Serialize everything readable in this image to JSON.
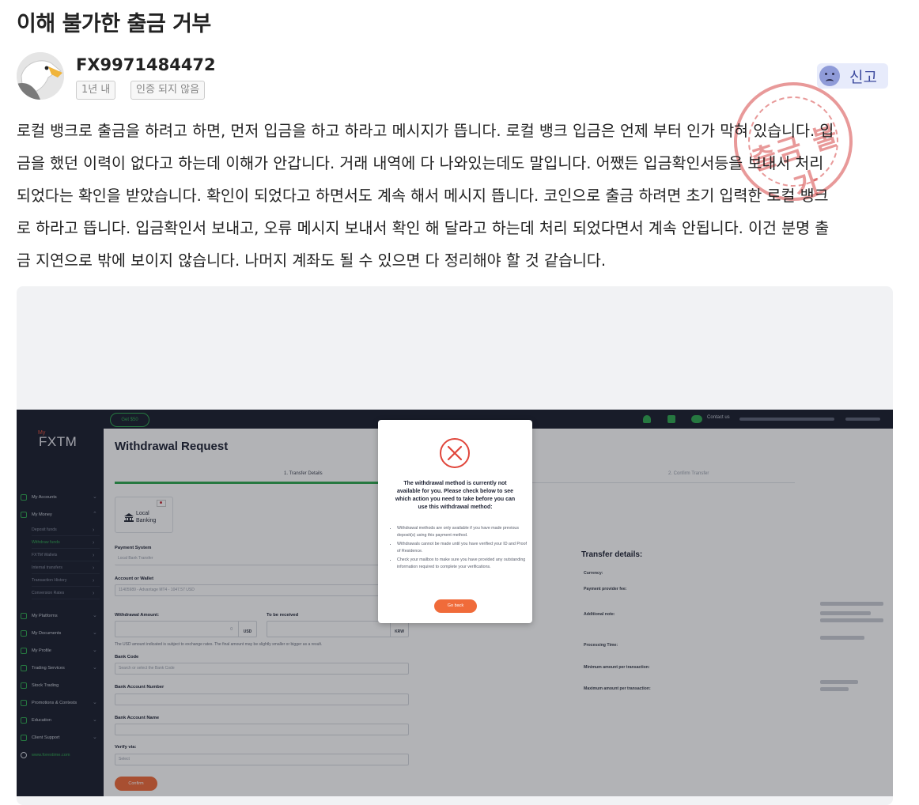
{
  "post": {
    "title": "이해 불가한 출금 거부",
    "author": "FX9971484472",
    "time_badge": "1년 내",
    "verify_badge": "인증 되지 않음",
    "report_label": "신고",
    "stamp_text": "출금 불가",
    "body_lines": [
      "로컬 뱅크로 출금을 하려고 하면, 먼저 입금을 하고 하라고 메시지가 뜹니다. 로컬 뱅크 입금은 언제 부터 인가 막혀 있습니다. 입",
      "금을 했던 이력이 없다고 하는데 이해가 안갑니다. 거래 내역에 다 나와있는데도 말입니다. 어쨌든 입금확인서등을 보내서 처리",
      "되었다는 확인을 받았습니다. 확인이 되었다고 하면서도 계속 해서 메시지 뜹니다. 코인으로 출금 하려면 초기 입력한 로컬 뱅크",
      "로 하라고 뜹니다. 입금확인서 보내고, 오류 메시지 보내서 확인 해 달라고 하는데 처리 되었다면서 계속 안됩니다. 이건 분명 출",
      "금 지연으로 밖에 보이지 않습니다. 나머지 계좌도 될 수 있으면 다 정리해야 할 것 같습니다."
    ]
  },
  "screenshot": {
    "topbar": {
      "get_label": "Get $50",
      "contact_label": "Contact us"
    },
    "sidebar": {
      "logo_my": "My",
      "logo": "FXTM",
      "items": [
        {
          "label": "My Accounts"
        },
        {
          "label": "My Money"
        },
        {
          "label": "My Platforms"
        },
        {
          "label": "My Documents"
        },
        {
          "label": "My Profile"
        },
        {
          "label": "Trading Services"
        },
        {
          "label": "Stock Trading"
        },
        {
          "label": "Promotions & Contests"
        },
        {
          "label": "Education"
        },
        {
          "label": "Client Support"
        },
        {
          "label": "www.forextime.com"
        }
      ],
      "subitems": [
        {
          "label": "Deposit funds"
        },
        {
          "label": "Withdraw funds"
        },
        {
          "label": "FXTM Wallets"
        },
        {
          "label": "Internal transfers"
        },
        {
          "label": "Transaction History"
        },
        {
          "label": "Conversion Rates"
        }
      ]
    },
    "main": {
      "heading": "Withdrawal Request",
      "step1": "1. Transfer Details",
      "step2": "2. Confirm Transfer",
      "local_banking": "Local Banking",
      "payment_system_label": "Payment System",
      "payment_system_value": "Local Bank Transfer",
      "account_label": "Account or Wallet",
      "account_value": "11405989 - Advantage MT4 - 1047.57 USD",
      "withdrawal_amount_label": "Withdrawal Amount:",
      "to_be_received_label": "To be received",
      "amount_value": "0",
      "currency_usd": "USD",
      "currency_krw": "KRW",
      "exchange_note": "The USD amount indicated is subject to exchange rates. The final amount may be slightly smaller or bigger as a result.",
      "bank_code_label": "Bank Code",
      "bank_code_placeholder": "Search or select the Bank Code",
      "bank_account_number_label": "Bank Account Number",
      "bank_account_name_label": "Bank Account Name",
      "verify_label": "Verify via:",
      "verify_value": "Select",
      "confirm_label": "Confirm"
    },
    "transfer_details": {
      "title": "Transfer details:",
      "rows": [
        {
          "label": "Currency:"
        },
        {
          "label": "Payment provider fee:"
        },
        {
          "label": "Additional note:"
        },
        {
          "label": "Processing Time:"
        },
        {
          "label": "Minimum amount per transaction:"
        },
        {
          "label": "Maximum amount per transaction:"
        }
      ]
    },
    "modal": {
      "title": "The withdrawal method is currently not available for you. Please check below to see which action you need to take before you can use this withdrawal method:",
      "bullets": [
        "Withdrawal methods are only available if you have made previous deposit(s) using this payment method.",
        "Withdrawals cannot be made until you have verified your ID and Proof of Residence.",
        "Check your mailbox to make sure you have provided any outstanding information required to complete your verifications."
      ],
      "button_label": "Go back"
    }
  },
  "colors": {
    "accent_green": "#2fa84f",
    "accent_orange": "#f06b3a",
    "sidebar_bg": "#1a1f2e",
    "report_bg": "#e7ebfb",
    "stamp_red": "#d64646"
  },
  "icons": [
    "eagle-avatar-icon",
    "sad-face-icon",
    "error-x-icon",
    "bell-icon",
    "mail-icon",
    "chat-icon",
    "bank-icon",
    "korea-flag-icon",
    "us-flag-icon"
  ]
}
